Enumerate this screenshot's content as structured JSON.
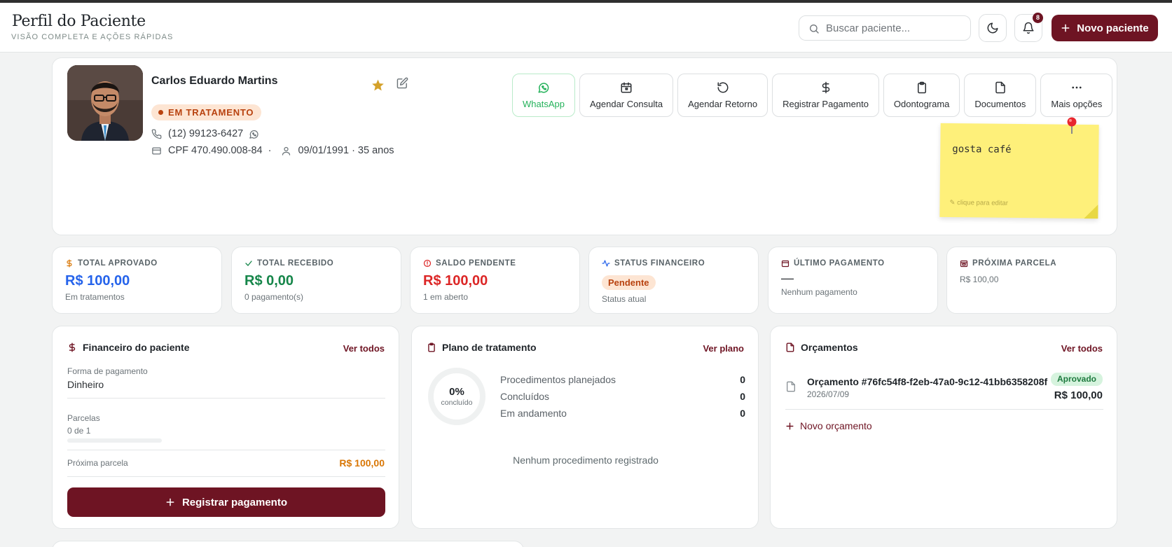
{
  "header": {
    "title": "Perfil do Paciente",
    "subtitle": "VISÃO COMPLETA E AÇÕES RÁPIDAS",
    "search_placeholder": "Buscar paciente...",
    "notification_count": "8",
    "new_patient_label": "Novo paciente"
  },
  "patient": {
    "name": "Carlos Eduardo Martins",
    "status": "EM TRATAMENTO",
    "phone": "(12) 99123-6427",
    "cpf": "CPF 470.490.008-84",
    "separator": "·",
    "birth": "09/01/1991 · 35 anos",
    "favorite": true
  },
  "actions": [
    {
      "label": "WhatsApp",
      "icon": "whatsapp-icon"
    },
    {
      "label": "Agendar Consulta",
      "icon": "calendar-icon"
    },
    {
      "label": "Agendar Retorno",
      "icon": "refresh-icon"
    },
    {
      "label": "Registrar Pagamento",
      "icon": "dollar-icon"
    },
    {
      "label": "Odontograma",
      "icon": "clipboard-icon"
    },
    {
      "label": "Documentos",
      "icon": "file-icon"
    },
    {
      "label": "Mais opções",
      "icon": "more-icon"
    }
  ],
  "sticky_note": {
    "text": "gosta café",
    "hint": "✎ clique para editar"
  },
  "stats": [
    {
      "label": "TOTAL APROVADO",
      "value": "R$ 100,00",
      "sub": "Em tratamentos",
      "color": "#2563eb"
    },
    {
      "label": "TOTAL RECEBIDO",
      "value": "R$ 0,00",
      "sub": "0 pagamento(s)",
      "color": "#16864a"
    },
    {
      "label": "SALDO PENDENTE",
      "value": "R$ 100,00",
      "sub": "1 em aberto",
      "color": "#dc2626"
    },
    {
      "label": "STATUS FINANCEIRO",
      "pill": "Pendente",
      "sub": "Status atual"
    },
    {
      "label": "ÚLTIMO PAGAMENTO",
      "value": "—",
      "sub": "Nenhum pagamento"
    },
    {
      "label": "PRÓXIMA PARCELA",
      "sub": "R$ 100,00"
    }
  ],
  "finance": {
    "title": "Financeiro do paciente",
    "link": "Ver todos",
    "payment_method_label": "Forma de pagamento",
    "payment_method": "Dinheiro",
    "installments_label": "Parcelas",
    "installments_value": "0 de 1",
    "installments_progress": 0,
    "next_installment_label": "Próxima parcela",
    "next_installment_value": "R$ 100,00",
    "register_button": "Registrar pagamento"
  },
  "plan": {
    "title": "Plano de tratamento",
    "link": "Ver plano",
    "percent": "0%",
    "percent_caption": "concluído",
    "progress": 0,
    "rows": [
      {
        "label": "Procedimentos planejados",
        "value": "0"
      },
      {
        "label": "Concluídos",
        "value": "0"
      },
      {
        "label": "Em andamento",
        "value": "0"
      }
    ],
    "empty": "Nenhum procedimento registrado"
  },
  "budgets": {
    "title": "Orçamentos",
    "link": "Ver todos",
    "item": {
      "title": "Orçamento #76fc54f8-f2eb-47a0-9c12-41bb6358208f",
      "date": "2026/07/09",
      "status": "Aprovado",
      "value": "R$ 100,00"
    },
    "new_label": "Novo orçamento"
  }
}
